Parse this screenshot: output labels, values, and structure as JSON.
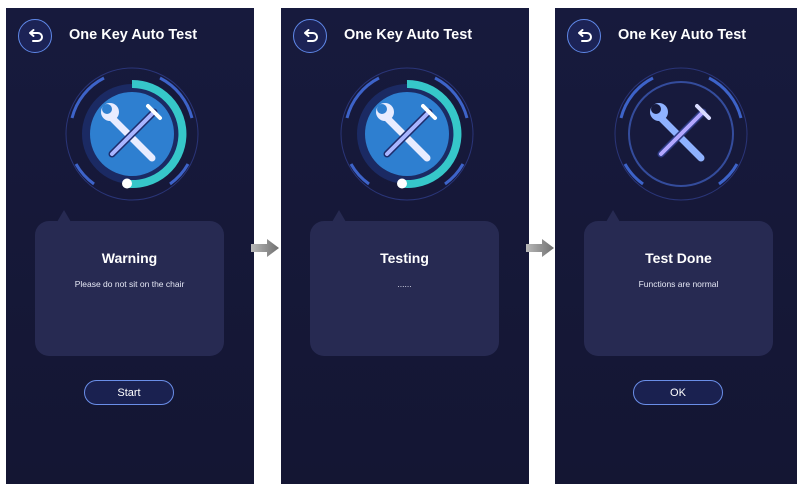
{
  "screens": [
    {
      "title": "One Key Auto Test",
      "card_title": "Warning",
      "card_message": "Please do not sit on the chair",
      "button_label": "Start",
      "state": "warning"
    },
    {
      "title": "One Key Auto Test",
      "card_title": "Testing",
      "card_message": "......",
      "state": "testing"
    },
    {
      "title": "One Key Auto Test",
      "card_title": "Test Done",
      "card_message": "Functions are normal",
      "button_label": "OK",
      "state": "done"
    }
  ],
  "icons": {
    "back": "back-arrow-icon",
    "tool": "wrench-screwdriver-icon",
    "flow": "next-step-arrow-icon"
  },
  "colors": {
    "background": "#161938",
    "card": "#272a52",
    "accent": "#5f88e8",
    "progress": "#36c7c9"
  }
}
